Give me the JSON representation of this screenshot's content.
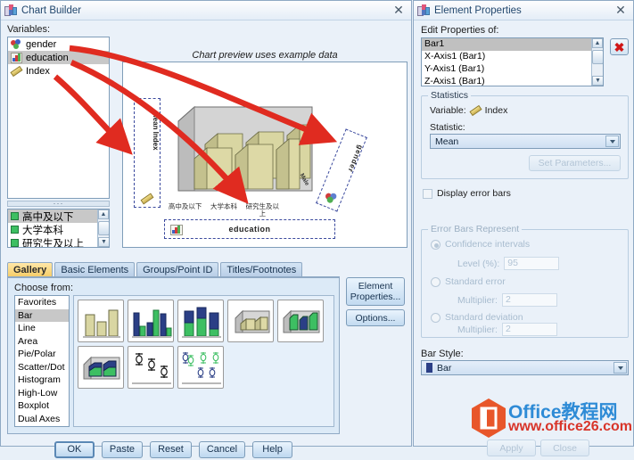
{
  "chart_builder": {
    "title": "Chart Builder",
    "icon": "chart-builder-icon",
    "close_label": "✕",
    "variables_label": "Variables:",
    "variables": [
      {
        "name": "gender",
        "measure_icon": "nominal-icon",
        "selected": false
      },
      {
        "name": "education",
        "measure_icon": "ordinal-icon",
        "selected": true
      },
      {
        "name": "Index",
        "measure_icon": "scale-icon",
        "selected": false
      }
    ],
    "splitter_dots": "···",
    "values": [
      {
        "label": "高中及以下",
        "selected": true
      },
      {
        "label": "大学本科",
        "selected": false
      },
      {
        "label": "研究生及以上",
        "selected": false
      }
    ],
    "preview": {
      "caption": "Chart preview uses example data",
      "yaxis_dropzone_text": "Mean Index",
      "yaxis_dropzone_icon": "scale-icon",
      "gender_dropzone_text": "gender",
      "gender_dropzone_icon": "nominal-icon",
      "education_dropzone_text": "education",
      "education_dropzone_icon": "ordinal-icon",
      "depth_label": "Male",
      "x_tick_labels": [
        "高中及以下",
        "大学本科",
        "研究生及以上"
      ]
    },
    "tabs": [
      {
        "label": "Gallery",
        "active": true
      },
      {
        "label": "Basic Elements",
        "active": false
      },
      {
        "label": "Groups/Point ID",
        "active": false
      },
      {
        "label": "Titles/Footnotes",
        "active": false
      }
    ],
    "gallery": {
      "choose_from_label": "Choose from:",
      "types": [
        {
          "label": "Favorites",
          "selected": false
        },
        {
          "label": "Bar",
          "selected": true
        },
        {
          "label": "Line",
          "selected": false
        },
        {
          "label": "Area",
          "selected": false
        },
        {
          "label": "Pie/Polar",
          "selected": false
        },
        {
          "label": "Scatter/Dot",
          "selected": false
        },
        {
          "label": "Histogram",
          "selected": false
        },
        {
          "label": "High-Low",
          "selected": false
        },
        {
          "label": "Boxplot",
          "selected": false
        },
        {
          "label": "Dual Axes",
          "selected": false
        }
      ],
      "thumbnails": [
        "simple-bar",
        "clustered-bar",
        "stacked-bar",
        "simple-3d-bar",
        "clustered-3d-bar",
        "stacked-3d-bar",
        "simple-error-bar",
        "clustered-error-bar"
      ]
    },
    "side_buttons": {
      "element_properties": "Element Properties...",
      "options": "Options..."
    },
    "bottom_buttons": [
      {
        "label": "OK",
        "default": true
      },
      {
        "label": "Paste",
        "default": false
      },
      {
        "label": "Reset",
        "default": false
      },
      {
        "label": "Cancel",
        "default": false
      },
      {
        "label": "Help",
        "default": false
      }
    ]
  },
  "element_properties": {
    "title": "Element Properties",
    "icon": "element-properties-icon",
    "close_label": "✕",
    "edit_properties_label": "Edit Properties of:",
    "property_items": [
      {
        "label": "Bar1",
        "selected": true
      },
      {
        "label": "X-Axis1 (Bar1)",
        "selected": false
      },
      {
        "label": "Y-Axis1 (Bar1)",
        "selected": false
      },
      {
        "label": "Z-Axis1 (Bar1)",
        "selected": false
      }
    ],
    "delete_button_label": "✖",
    "statistics": {
      "group_label": "Statistics",
      "variable_label": "Variable:",
      "variable_value": "Index",
      "variable_icon": "scale-icon",
      "statistic_label": "Statistic:",
      "statistic_value": "Mean",
      "set_parameters_label": "Set Parameters...",
      "set_parameters_enabled": false
    },
    "display_error_bars": {
      "label": "Display error bars",
      "checked": false
    },
    "error_bars": {
      "group_label": "Error Bars Represent",
      "enabled": false,
      "options": [
        {
          "label": "Confidence intervals",
          "selected": true,
          "field_label": "Level (%):",
          "field_value": "95"
        },
        {
          "label": "Standard error",
          "selected": false,
          "field_label": "Multiplier:",
          "field_value": "2"
        },
        {
          "label": "Standard deviation",
          "selected": false,
          "field_label": "Multiplier:",
          "field_value": "2"
        }
      ]
    },
    "bar_style": {
      "label": "Bar Style:",
      "value": "Bar"
    },
    "footer_buttons": [
      {
        "label": "Apply",
        "enabled": false
      },
      {
        "label": "Close",
        "enabled": false
      }
    ]
  },
  "watermark": {
    "brand": "Office教程网",
    "url": "www.office26.com",
    "icon": "office-hex-icon"
  },
  "annotations": {
    "arrow_color": "#e02b20",
    "arrows": [
      {
        "name": "gender-to-gender-dropzone"
      },
      {
        "name": "education-to-education-dropzone"
      },
      {
        "name": "index-to-yaxis-dropzone"
      }
    ]
  }
}
